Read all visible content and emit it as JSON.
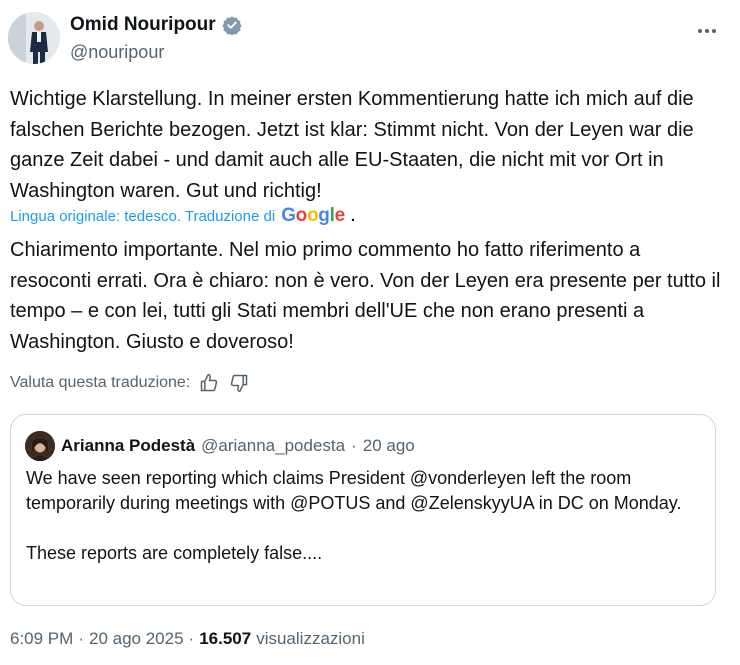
{
  "author": {
    "name": "Omid Nouripour",
    "handle": "@nouripour",
    "verified": true
  },
  "tweet": {
    "original_text": "Wichtige Klarstellung. In meiner ersten Kommentierung hatte ich mich auf die falschen Berichte bezogen. Jetzt ist klar: Stimmt nicht. Von der Leyen war die ganze Zeit dabei - und damit auch alle EU-Staaten, die nicht mit vor Ort in Washington waren. Gut und richtig!",
    "translation_note": "Lingua originale: tedesco. Traduzione di",
    "translation_provider": "Google",
    "translation_note_end": ".",
    "translated_text": "Chiarimento importante. Nel mio primo commento ho fatto riferimento a resoconti errati. Ora è chiaro: non è vero. Von der Leyen era presente per tutto il tempo – e con lei, tutti gli Stati membri dell'UE che non erano presenti a Washington. Giusto e doveroso!",
    "rate_label": "Valuta questa traduzione:"
  },
  "quoted_tweet": {
    "name": "Arianna Podestà",
    "handle": "@arianna_podesta",
    "separator": "·",
    "time": "20 ago",
    "text": "We have seen reporting which claims President @vonderleyen left the room temporarily during meetings with @POTUS and @ZelenskyyUA in DC on Monday.\n\nThese reports are completely false...."
  },
  "meta": {
    "time": "6:09 PM",
    "sep1": "·",
    "date": "20 ago 2025",
    "sep2": "·",
    "views": "16.507",
    "views_label": "visualizzazioni"
  },
  "colors": {
    "accent": "#1d9bf0",
    "text": "#0f1419",
    "muted": "#536471",
    "border": "#cfd9de"
  }
}
